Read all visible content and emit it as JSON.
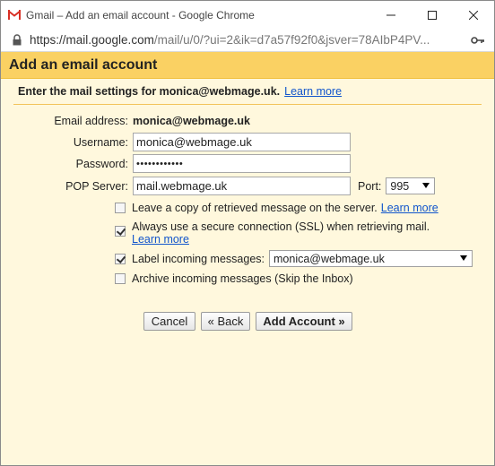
{
  "window": {
    "title": "Gmail – Add an email account - Google Chrome",
    "url_main": "https://mail.google.com",
    "url_rest": "/mail/u/0/?ui=2&ik=d7a57f92f0&jsver=78AIbP4PV..."
  },
  "heading": "Add an email account",
  "intro": {
    "text": "Enter the mail settings for monica@webmage.uk.",
    "learn_more": "Learn more"
  },
  "form": {
    "email_label": "Email address:",
    "email_value": "monica@webmage.uk",
    "username_label": "Username:",
    "username_value": "monica@webmage.uk",
    "password_label": "Password:",
    "password_value": "••••••••••••",
    "pop_label": "POP Server:",
    "pop_value": "mail.webmage.uk",
    "port_label": "Port:",
    "port_value": "995",
    "leave_copy": "Leave a copy of retrieved message on the server.",
    "leave_copy_link": "Learn more",
    "leave_copy_checked": false,
    "ssl": "Always use a secure connection (SSL) when retrieving mail.",
    "ssl_link": "Learn more",
    "ssl_checked": true,
    "label_incoming": "Label incoming messages:",
    "label_incoming_value": "monica@webmage.uk",
    "label_incoming_checked": true,
    "archive": "Archive incoming messages (Skip the Inbox)",
    "archive_checked": false
  },
  "buttons": {
    "cancel": "Cancel",
    "back": "« Back",
    "add_account": "Add Account »"
  },
  "colors": {
    "heading_bg": "#fad163",
    "body_bg": "#fff8dd",
    "link": "#1155cc"
  }
}
